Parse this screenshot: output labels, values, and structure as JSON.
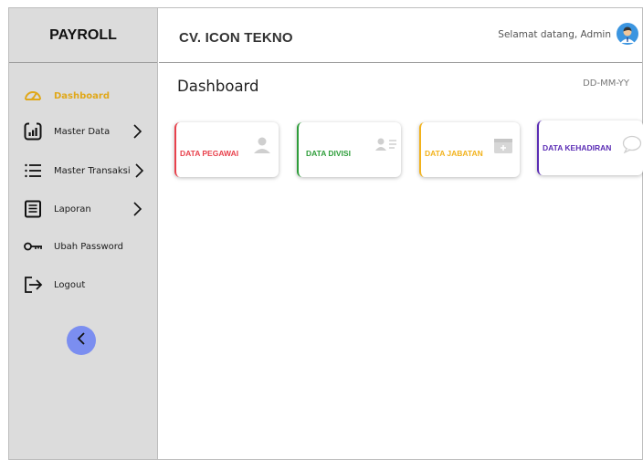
{
  "sidebar": {
    "brand": "PAYROLL",
    "items": [
      {
        "label": "Dashboard",
        "icon": "speedometer-icon",
        "active": true
      },
      {
        "label": "Master Data",
        "icon": "chart-box-icon",
        "has_submenu": true
      },
      {
        "label": "Master Transaksi",
        "icon": "list-icon",
        "has_submenu": true
      },
      {
        "label": "Laporan",
        "icon": "report-icon",
        "has_submenu": true
      },
      {
        "label": "Ubah Password",
        "icon": "key-icon"
      },
      {
        "label": "Logout",
        "icon": "logout-icon"
      }
    ],
    "collapse_icon": "chevron-left-icon"
  },
  "header": {
    "company": "CV. ICON TEKNO",
    "welcome": "Selamat datang, Admin",
    "avatar_icon": "user-avatar-icon"
  },
  "main": {
    "title": "Dashboard",
    "date": "DD-MM-YY",
    "cards": [
      {
        "label": "DATA PEGAWAI",
        "color": "#e8414c",
        "icon": "person-icon"
      },
      {
        "label": "DATA DIVISI",
        "color": "#2e9d3a",
        "icon": "contact-card-icon"
      },
      {
        "label": "DATA JABATAN",
        "color": "#f2b21b",
        "icon": "calendar-plus-icon"
      },
      {
        "label": "DATA KEHADIRAN",
        "color": "#5b2db5",
        "icon": "chat-bubble-icon"
      }
    ]
  },
  "colors": {
    "sidebar_bg": "#dcdcdc",
    "active": "#e0a81a",
    "collapse_button": "#7b8ef0"
  }
}
